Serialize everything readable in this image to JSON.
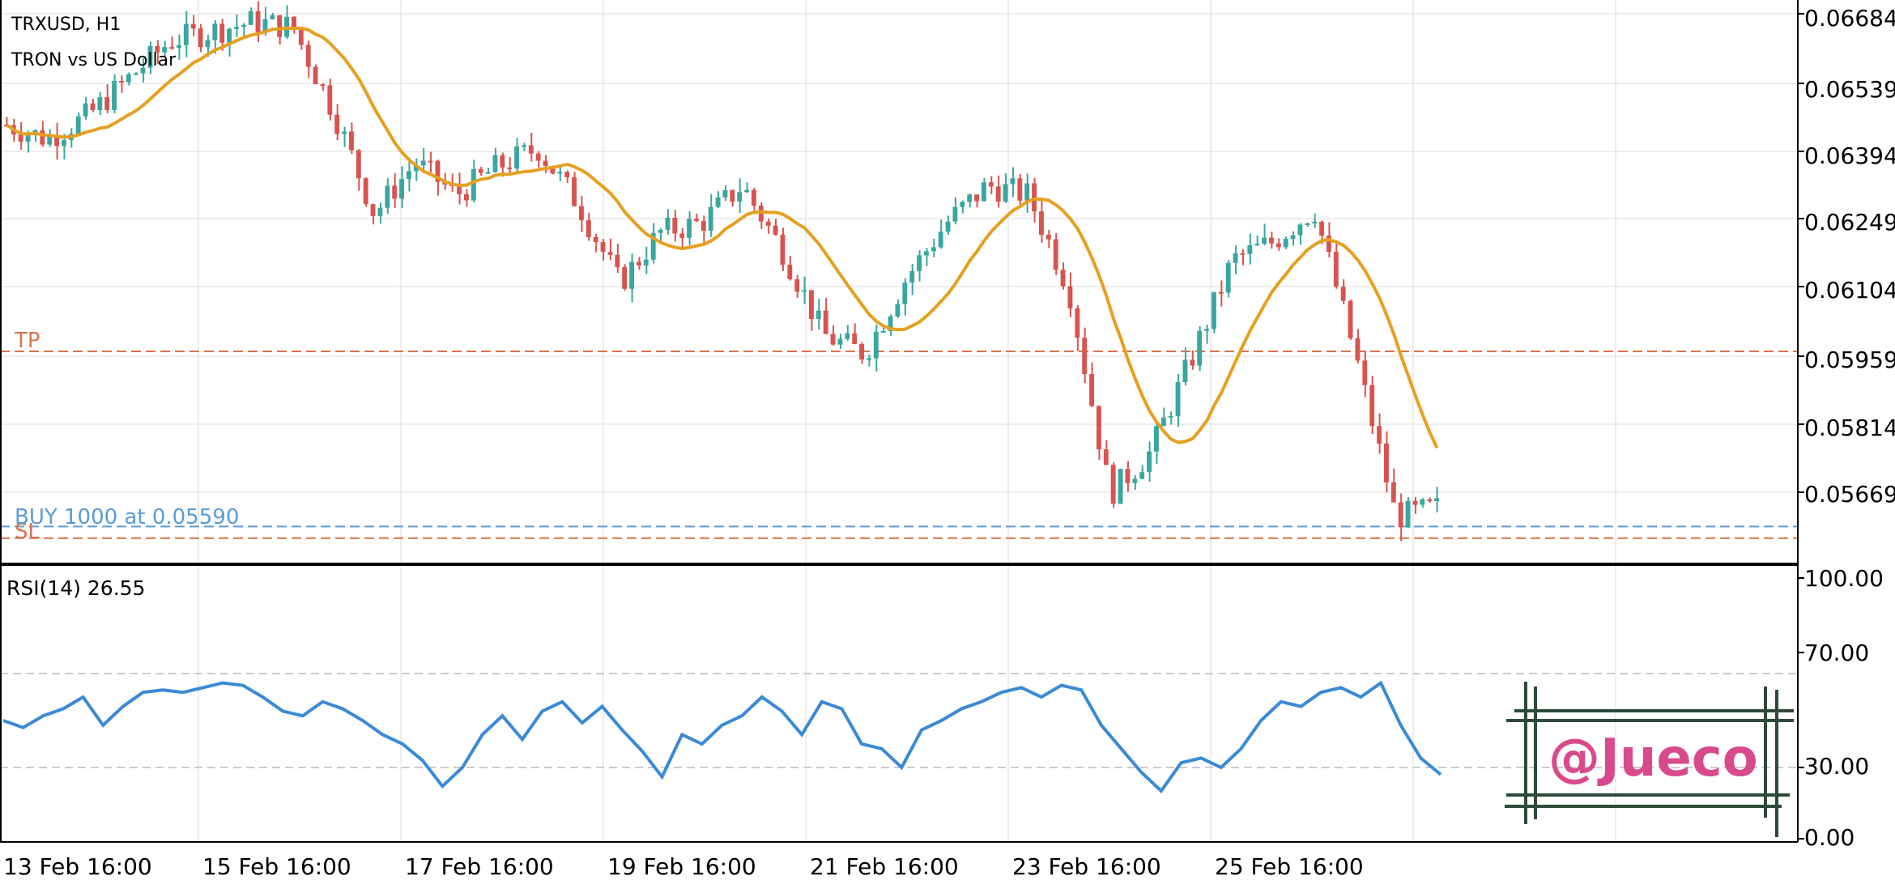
{
  "symbol_line": "TRXUSD, H1",
  "description": "TRON vs US Dollar",
  "colors": {
    "bull": "#3aa6a0",
    "bear": "#d9534f",
    "ma": "#e6a020",
    "rsi": "#3a8ad6",
    "tp_sl": "#d9734e",
    "buy": "#5b9bd5",
    "grid": "#dddddd",
    "watermark": "#d94a8c",
    "frame": "#2f4a3a"
  },
  "price_axis": {
    "ticks": [
      "0.06684",
      "0.06539",
      "0.06394",
      "0.06249",
      "0.06104",
      "0.05959",
      "0.05814",
      "0.05669"
    ],
    "range": [
      0.0553,
      0.067
    ]
  },
  "rsi_axis": {
    "ticks": [
      "100.00",
      "70.00",
      "30.00",
      "0.00"
    ]
  },
  "time_axis": {
    "labels": [
      "13 Feb 16:00",
      "15 Feb 16:00",
      "17 Feb 16:00",
      "19 Feb 16:00",
      "21 Feb 16:00",
      "23 Feb 16:00",
      "25 Feb 16:00"
    ]
  },
  "trade_lines": {
    "tp_label": "TP",
    "tp_price": 0.05965,
    "buy_label": "BUY 1000 at 0.05590",
    "buy_price": 0.0559,
    "sl_label": "SL",
    "sl_price": 0.05565
  },
  "rsi_panel": {
    "title": "RSI(14) 26.55",
    "levels": [
      70,
      30
    ]
  },
  "watermark": "@Jueco",
  "chart_data": {
    "type": "line",
    "title": "TRXUSD, H1",
    "subtitle": "TRON vs US Dollar",
    "x": [
      "13 Feb 16:00",
      "15 Feb 16:00",
      "17 Feb 16:00",
      "19 Feb 16:00",
      "21 Feb 16:00",
      "23 Feb 16:00",
      "25 Feb 16:00"
    ],
    "series": [
      {
        "name": "",
        "description": "approximate close prices along the chart",
        "values": [
          0.0645,
          0.0642,
          0.0647,
          0.0655,
          0.0663,
          0.0665,
          0.0667,
          0.0666,
          0.0648,
          0.0626,
          0.0637,
          0.063,
          0.0636,
          0.064,
          0.0628,
          0.0611,
          0.0622,
          0.0624,
          0.0632,
          0.0618,
          0.06,
          0.0596,
          0.0612,
          0.0624,
          0.0632,
          0.063,
          0.061,
          0.0566,
          0.0575,
          0.0595,
          0.0616,
          0.062,
          0.0627,
          0.0596,
          0.0561,
          0.0563
        ]
      }
    ],
    "ylim": [
      0.0553,
      0.067
    ],
    "rsi": {
      "name": "RSI(14)",
      "ylim": [
        0,
        100
      ],
      "values": [
        50,
        47,
        52,
        55,
        60,
        48,
        56,
        62,
        63,
        62,
        64,
        66,
        65,
        60,
        54,
        52,
        58,
        55,
        50,
        44,
        40,
        33,
        22,
        30,
        44,
        52,
        42,
        54,
        58,
        49,
        56,
        46,
        37,
        26,
        44,
        40,
        48,
        52,
        60,
        54,
        44,
        58,
        55,
        40,
        38,
        30,
        46,
        50,
        55,
        58,
        62,
        64,
        60,
        65,
        63,
        48,
        38,
        28,
        20,
        32,
        34,
        30,
        38,
        50,
        58,
        56,
        62,
        64,
        60,
        66,
        48,
        34,
        27
      ]
    }
  }
}
